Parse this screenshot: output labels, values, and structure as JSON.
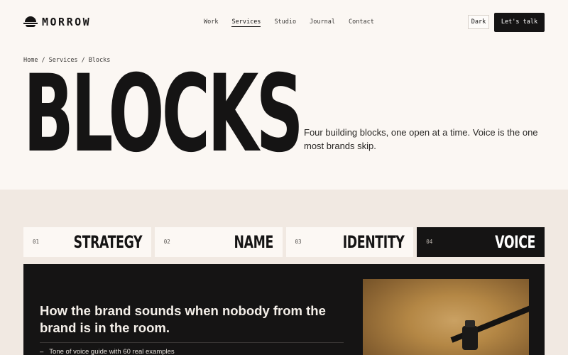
{
  "brand": {
    "name": "MORROW"
  },
  "nav": {
    "items": [
      "Work",
      "Services",
      "Studio",
      "Journal",
      "Contact"
    ],
    "active": "Services"
  },
  "header": {
    "theme_toggle": "Dark",
    "cta": "Let's talk"
  },
  "breadcrumb": [
    "Home",
    "Services",
    "Blocks"
  ],
  "hero": {
    "title": "BLOCKS",
    "lede": "Four building blocks, one open at a time. Voice is the one most brands skip."
  },
  "tabs": [
    {
      "num": "01",
      "label": "STRATEGY",
      "active": false
    },
    {
      "num": "02",
      "label": "NAME",
      "active": false
    },
    {
      "num": "03",
      "label": "IDENTITY",
      "active": false
    },
    {
      "num": "04",
      "label": "VOICE",
      "active": true
    }
  ],
  "panel": {
    "heading": "How the brand sounds when nobody from the brand is in the room.",
    "list": [
      "Tone of voice guide with 60 real examples"
    ],
    "image_icon": "microphone-photo"
  },
  "colors": {
    "ink": "#151414",
    "paper": "#fbf7f3",
    "band": "#f1e9e2"
  }
}
